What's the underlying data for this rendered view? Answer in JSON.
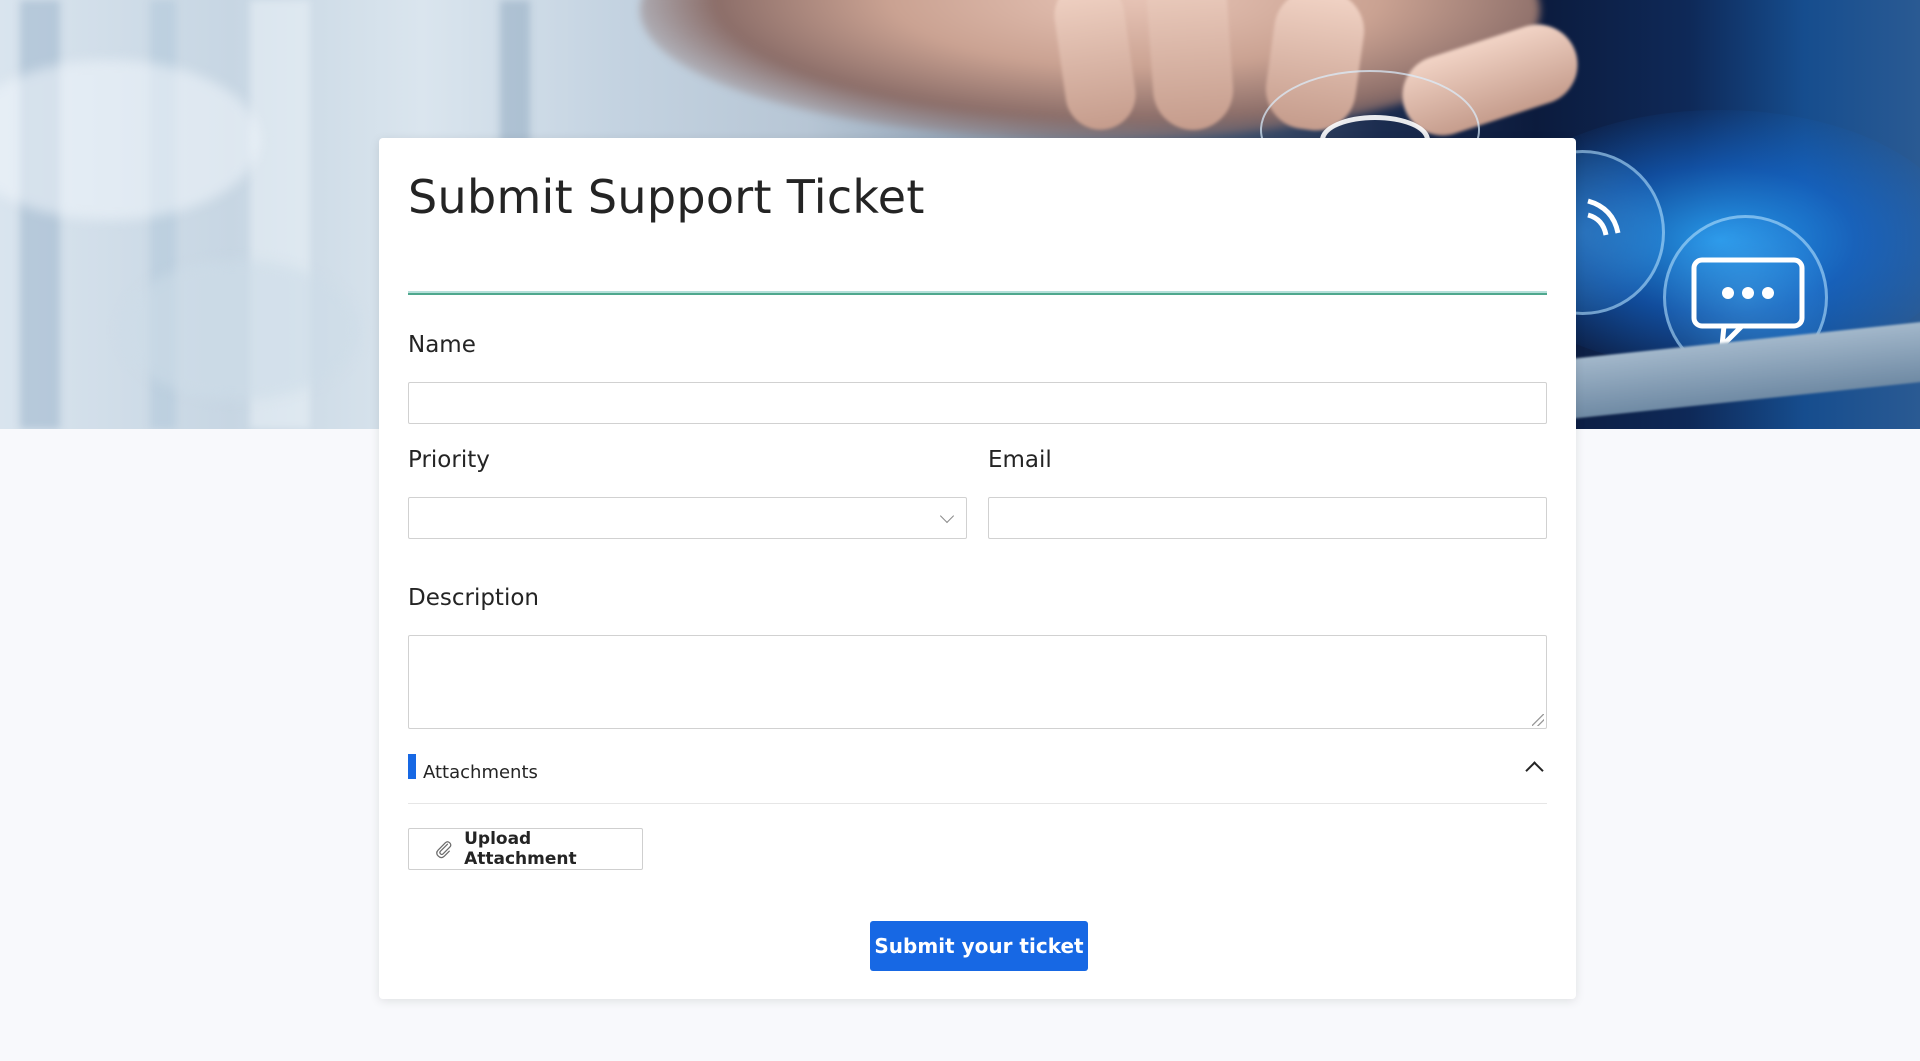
{
  "form": {
    "title": "Submit Support Ticket",
    "name_label": "Name",
    "name_value": "",
    "priority_label": "Priority",
    "priority_value": "",
    "email_label": "Email",
    "email_value": "",
    "description_label": "Description",
    "description_value": ""
  },
  "attachments": {
    "section_label": "Attachments",
    "upload_label": "Upload Attachment",
    "expanded": true
  },
  "actions": {
    "submit_label": "Submit your ticket"
  },
  "colors": {
    "accent": "#1768e4",
    "page_background": "#f8f9fc",
    "title_rule": "#4fa88e"
  },
  "icons": {
    "select_arrow": "chevron-down-icon",
    "collapse": "chevron-up-icon",
    "upload": "paperclip-icon",
    "hero_phone": "phone-icon",
    "hero_chat": "chat-bubble-icon"
  }
}
